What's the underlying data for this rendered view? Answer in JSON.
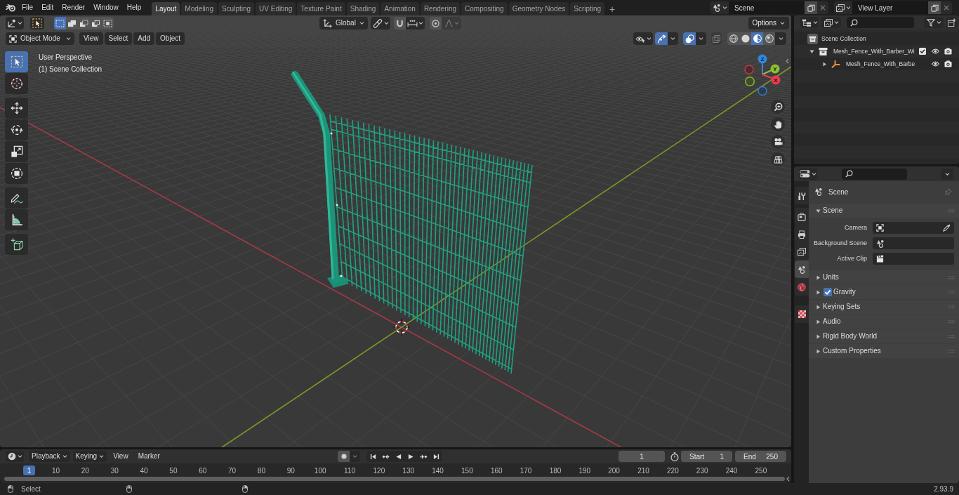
{
  "top_bar": {
    "menus": [
      "File",
      "Edit",
      "Render",
      "Window",
      "Help"
    ],
    "workspaces": [
      {
        "label": "Layout",
        "selected": true
      },
      {
        "label": "Modeling",
        "selected": false
      },
      {
        "label": "Sculpting",
        "selected": false
      },
      {
        "label": "UV Editing",
        "selected": false
      },
      {
        "label": "Texture Paint",
        "selected": false
      },
      {
        "label": "Shading",
        "selected": false
      },
      {
        "label": "Animation",
        "selected": false
      },
      {
        "label": "Rendering",
        "selected": false
      },
      {
        "label": "Compositing",
        "selected": false
      },
      {
        "label": "Geometry Nodes",
        "selected": false
      },
      {
        "label": "Scripting",
        "selected": false
      }
    ],
    "add_workspace": "+",
    "scene": "Scene",
    "view_layer": "View Layer"
  },
  "viewport": {
    "tool_settings": {
      "selection_modes": [
        {
          "kind": "set",
          "selected": true
        },
        {
          "kind": "extend",
          "selected": false
        },
        {
          "kind": "subtract",
          "selected": false
        },
        {
          "kind": "invert",
          "selected": false
        },
        {
          "kind": "intersect",
          "selected": false
        }
      ],
      "orientation": "Global",
      "snapping": {
        "on": false
      },
      "proportional_editing": {
        "on": false
      },
      "options": "Options"
    },
    "header": {
      "mode": "Object Mode",
      "menus": [
        "View",
        "Select",
        "Add",
        "Object"
      ],
      "toggles": [
        {
          "kind": "gizmos",
          "on": true
        },
        {
          "kind": "overlays",
          "on": true
        },
        {
          "kind": "xray",
          "on": false
        }
      ],
      "shading_modes": [
        {
          "kind": "wireframe",
          "selected": false
        },
        {
          "kind": "solid",
          "selected": false
        },
        {
          "kind": "material",
          "selected": true
        },
        {
          "kind": "rendered",
          "selected": false
        }
      ]
    },
    "tool_groups": [
      {
        "tools": [
          {
            "kind": "select",
            "selected": true
          },
          {
            "kind": "cursor",
            "selected": false
          }
        ]
      },
      {
        "tools": [
          {
            "kind": "move",
            "selected": false
          },
          {
            "kind": "rotate",
            "selected": false
          },
          {
            "kind": "scale",
            "selected": false
          },
          {
            "kind": "transform",
            "selected": false
          }
        ]
      },
      {
        "tools": [
          {
            "kind": "annotate",
            "selected": false
          },
          {
            "kind": "measure",
            "selected": false
          }
        ]
      },
      {
        "tools": [
          {
            "kind": "add_cube",
            "selected": false
          }
        ]
      }
    ],
    "view_name": "User Perspective",
    "collection_info": "(1) Scene Collection",
    "axis_labels": {
      "x": "X",
      "y": "Y",
      "z": "Z"
    }
  },
  "outliner": {
    "tree": [
      {
        "label": "Scene Collection",
        "kind": "scene_collection",
        "children": [
          {
            "label": "Mesh_Fence_With_Barber_Wi",
            "kind": "collection",
            "expanded": true,
            "checked": true,
            "children": [
              {
                "label": "Mesh_Fence_With_Barbe",
                "kind": "object",
                "expanded": false
              }
            ]
          }
        ]
      }
    ]
  },
  "properties": {
    "tab_groups": [
      {
        "tabs": [
          {
            "kind": "tool",
            "selected": false
          }
        ]
      },
      {
        "tabs": [
          {
            "kind": "render",
            "selected": false
          },
          {
            "kind": "output",
            "selected": false
          },
          {
            "kind": "view_layer",
            "selected": false
          },
          {
            "kind": "scene",
            "selected": true
          },
          {
            "kind": "world",
            "selected": false
          }
        ]
      },
      {
        "tabs": [
          {
            "kind": "texture",
            "selected": false
          }
        ]
      }
    ],
    "context": "Scene",
    "panels": [
      {
        "label": "Scene",
        "kind": "plain",
        "expanded": true,
        "fields": [
          {
            "label": "Camera",
            "kind": "camera"
          },
          {
            "label": "Background Scene",
            "kind": "scene"
          },
          {
            "label": "Active Clip",
            "kind": "clip"
          }
        ]
      },
      {
        "label": "Units",
        "kind": "plain",
        "expanded": false
      },
      {
        "label": "Gravity",
        "kind": "checkbox",
        "expanded": false,
        "checked": true
      },
      {
        "label": "Keying Sets",
        "kind": "plain",
        "expanded": false
      },
      {
        "label": "Audio",
        "kind": "plain",
        "expanded": false
      },
      {
        "label": "Rigid Body World",
        "kind": "plain",
        "expanded": false
      },
      {
        "label": "Custom Properties",
        "kind": "plain",
        "expanded": false
      }
    ]
  },
  "timeline": {
    "menus": [
      {
        "label": "Playback",
        "kind": "dropdown"
      },
      {
        "label": "Keying",
        "kind": "dropdown"
      },
      {
        "label": "View",
        "kind": "menu"
      },
      {
        "label": "Marker",
        "kind": "menu"
      }
    ],
    "current_frame": "1",
    "start": {
      "label": "Start",
      "value": "1"
    },
    "end": {
      "label": "End",
      "value": "250"
    },
    "playhead": "1",
    "frame_labels": [
      "10",
      "20",
      "30",
      "40",
      "50",
      "60",
      "70",
      "80",
      "90",
      "100",
      "110",
      "120",
      "130",
      "140",
      "150",
      "160",
      "170",
      "180",
      "190",
      "200",
      "210",
      "220",
      "230",
      "240",
      "250"
    ]
  },
  "status_bar": {
    "hint": "Select",
    "version": "2.93.9"
  }
}
